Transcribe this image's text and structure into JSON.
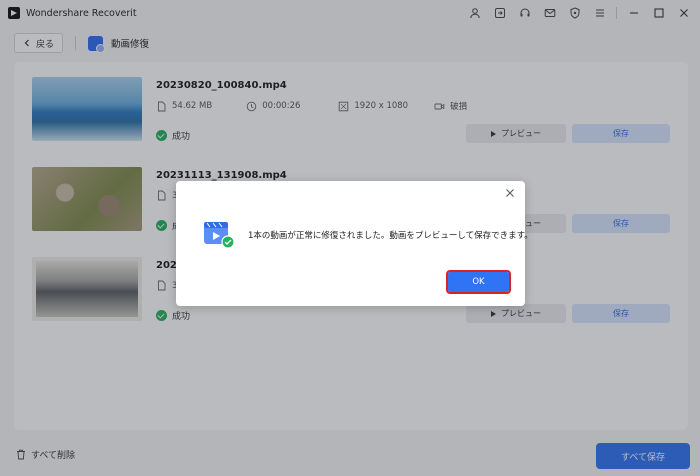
{
  "app": {
    "title": "Wondershare Recoverit"
  },
  "titlebar": {
    "icons": [
      "user-icon",
      "sign-in-icon",
      "headset-icon",
      "mail-icon",
      "shield-icon",
      "menu-icon",
      "minimize-icon",
      "maximize-icon",
      "close-icon"
    ]
  },
  "nav": {
    "back_label": "戻る",
    "page_title": "動画修復"
  },
  "files": [
    {
      "name": "20230820_100840.mp4",
      "size": "54.62  MB",
      "duration": "00:00:26",
      "resolution": "1920 x 1080",
      "state": "破損",
      "status": "成功",
      "preview_label": "プレビュー",
      "save_label": "保存"
    },
    {
      "name": "20231113_131908.mp4",
      "size_partial": "3",
      "status_partial": "成",
      "preview_label": "プレビュー",
      "save_label": "保存"
    },
    {
      "name_partial": "2024",
      "size_partial": "3",
      "status": "成功",
      "preview_label": "プレビュー",
      "save_label": "保存"
    }
  ],
  "footer": {
    "delete_all_label": "すべて削除",
    "save_all_label": "すべて保存"
  },
  "dialog": {
    "message": "1本の動画が正常に修復されました。動画をプレビューして保存できます。",
    "ok_label": "OK"
  },
  "colors": {
    "accent": "#2f74f4",
    "success": "#22b35e",
    "highlight": "#dd2222"
  }
}
